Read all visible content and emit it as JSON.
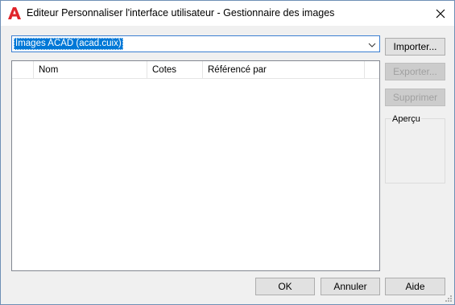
{
  "window": {
    "title": "Editeur Personnaliser l'interface utilisateur - Gestionnaire des images"
  },
  "icons": {
    "app": "autocad-a-icon",
    "close": "close-icon",
    "dropdown": "chevron-down-icon",
    "grip": "resize-grip-icon"
  },
  "colors": {
    "accent": "#0078d7",
    "app_icon_red": "#e0242a"
  },
  "source_select": {
    "value": "Images ACAD (acad.cuix)"
  },
  "image_list": {
    "columns": [
      "",
      "Nom",
      "Cotes",
      "Référencé par"
    ],
    "rows": []
  },
  "side_buttons": {
    "import_label": "Importer...",
    "export_label": "Exporter...",
    "delete_label": "Supprimer"
  },
  "preview": {
    "label": "Aperçu"
  },
  "footer": {
    "ok_label": "OK",
    "cancel_label": "Annuler",
    "help_label": "Aide"
  }
}
